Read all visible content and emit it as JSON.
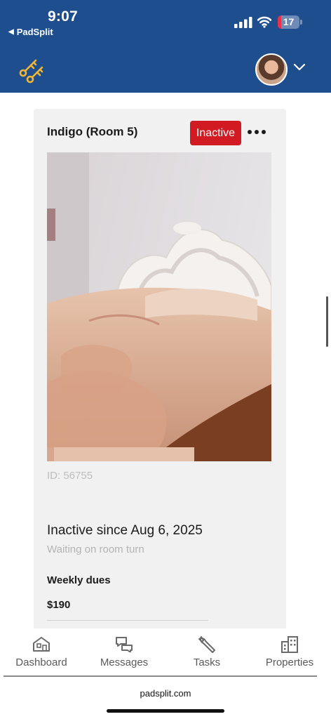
{
  "status_bar": {
    "time": "9:07",
    "back_app": "PadSplit",
    "battery": "17",
    "battery_level": 0.17,
    "battery_color": "#e8314a"
  },
  "app_bar": {
    "logo_icon": "keys-icon",
    "avatar_icon": "user-avatar",
    "menu_icon": "chevron-down-icon",
    "background": "#1f4e8f"
  },
  "room": {
    "name": "Indigo (Room 5)",
    "status": "Inactive",
    "status_color": "#d11a22",
    "menu_icon": "more-horizontal-icon",
    "id_text": "ID: 56755",
    "inactive_since": "Inactive since Aug 6, 2025",
    "substatus": "Waiting on room turn",
    "dues_label": "Weekly dues",
    "dues_value": "$190"
  },
  "bottom_nav": {
    "items": [
      {
        "label": "Dashboard",
        "icon": "house-icon"
      },
      {
        "label": "Messages",
        "icon": "chat-bubbles-icon"
      },
      {
        "label": "Tasks",
        "icon": "wrench-icon"
      },
      {
        "label": "Properties",
        "icon": "buildings-icon"
      }
    ]
  },
  "browser": {
    "domain": "padsplit.com"
  }
}
